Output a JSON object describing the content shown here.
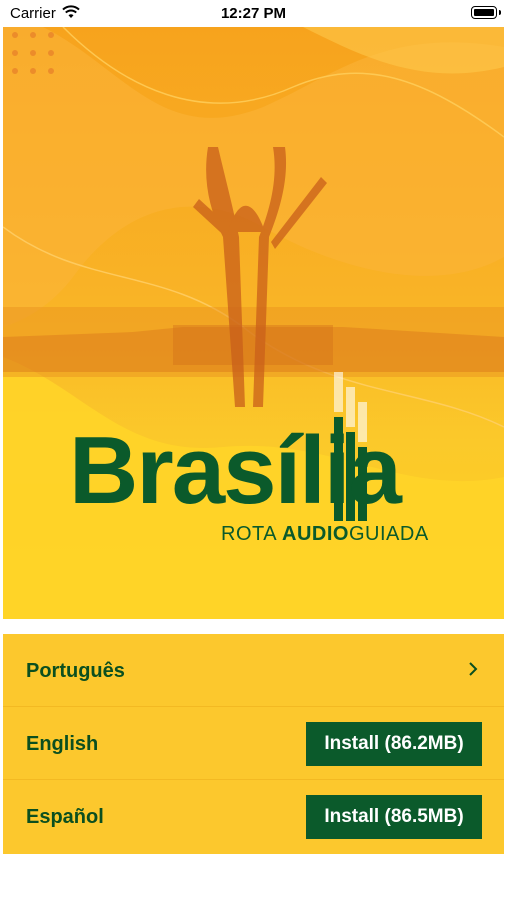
{
  "status_bar": {
    "carrier": "Carrier",
    "time": "12:27 PM"
  },
  "hero": {
    "title": "Brasília",
    "subtitle_light": "ROTA",
    "subtitle_bold": "AUDIO",
    "subtitle_light_end": "GUIADA"
  },
  "languages": [
    {
      "label": "Português",
      "action": "chevron-right-icon"
    },
    {
      "label": "English",
      "install_label": "Install (86.2MB)"
    },
    {
      "label": "Español",
      "install_label": "Install (86.5MB)"
    }
  ],
  "colors": {
    "brand_green": "#0b5a2b",
    "list_yellow": "#fcc82d",
    "hero_orange": "#f7a31d"
  }
}
